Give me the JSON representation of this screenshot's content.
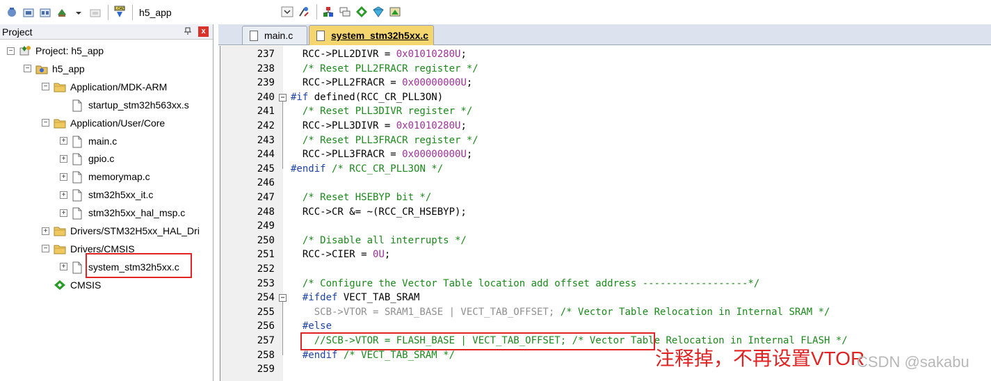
{
  "toolbar": {
    "target_label": "h5_app"
  },
  "project_panel": {
    "title": "Project",
    "pin": "ᴥ",
    "close": "x",
    "tree": [
      {
        "label": "Project: h5_app",
        "level": 0,
        "expanded": true,
        "icon": "project-icon"
      },
      {
        "label": "h5_app",
        "level": 1,
        "expanded": true,
        "icon": "target-icon"
      },
      {
        "label": "Application/MDK-ARM",
        "level": 2,
        "expanded": true,
        "icon": "folder-icon"
      },
      {
        "label": "startup_stm32h563xx.s",
        "level": 3,
        "expanded": null,
        "icon": "file-icon"
      },
      {
        "label": "Application/User/Core",
        "level": 2,
        "expanded": true,
        "icon": "folder-icon"
      },
      {
        "label": "main.c",
        "level": 3,
        "expanded": false,
        "icon": "file-icon"
      },
      {
        "label": "gpio.c",
        "level": 3,
        "expanded": false,
        "icon": "file-icon"
      },
      {
        "label": "memorymap.c",
        "level": 3,
        "expanded": false,
        "icon": "file-icon"
      },
      {
        "label": "stm32h5xx_it.c",
        "level": 3,
        "expanded": false,
        "icon": "file-icon"
      },
      {
        "label": "stm32h5xx_hal_msp.c",
        "level": 3,
        "expanded": false,
        "icon": "file-icon"
      },
      {
        "label": "Drivers/STM32H5xx_HAL_Dri",
        "level": 2,
        "expanded": false,
        "icon": "folder-icon"
      },
      {
        "label": "Drivers/CMSIS",
        "level": 2,
        "expanded": true,
        "icon": "folder-icon"
      },
      {
        "label": "system_stm32h5xx.c",
        "level": 3,
        "expanded": false,
        "icon": "file-icon"
      },
      {
        "label": "CMSIS",
        "level": 2,
        "expanded": null,
        "icon": "cmsis-icon"
      }
    ]
  },
  "tabs": [
    {
      "label": "main.c",
      "active": false
    },
    {
      "label": "system_stm32h5xx.c",
      "active": true
    }
  ],
  "editor": {
    "lines": [
      {
        "n": "237",
        "segs": [
          [
            "t",
            "  RCC->PLL2DIVR = "
          ],
          [
            "num",
            "0x01010280U"
          ],
          [
            "t",
            ";"
          ]
        ]
      },
      {
        "n": "238",
        "segs": [
          [
            "cm",
            "  /* Reset PLL2FRACR register */"
          ]
        ]
      },
      {
        "n": "239",
        "segs": [
          [
            "t",
            "  RCC->PLL2FRACR = "
          ],
          [
            "num",
            "0x00000000U"
          ],
          [
            "t",
            ";"
          ]
        ]
      },
      {
        "n": "240",
        "segs": [
          [
            "pp",
            "#if "
          ],
          [
            "t",
            "defined(RCC_CR_PLL3ON)"
          ]
        ],
        "fold": "-"
      },
      {
        "n": "241",
        "segs": [
          [
            "cm",
            "  /* Reset PLL3DIVR register */"
          ]
        ]
      },
      {
        "n": "242",
        "segs": [
          [
            "t",
            "  RCC->PLL3DIVR = "
          ],
          [
            "num",
            "0x01010280U"
          ],
          [
            "t",
            ";"
          ]
        ]
      },
      {
        "n": "243",
        "segs": [
          [
            "cm",
            "  /* Reset PLL3FRACR register */"
          ]
        ]
      },
      {
        "n": "244",
        "segs": [
          [
            "t",
            "  RCC->PLL3FRACR = "
          ],
          [
            "num",
            "0x00000000U"
          ],
          [
            "t",
            ";"
          ]
        ]
      },
      {
        "n": "245",
        "segs": [
          [
            "pp",
            "#endif "
          ],
          [
            "cm",
            "/* RCC_CR_PLL3ON */"
          ]
        ]
      },
      {
        "n": "246",
        "segs": [
          [
            "t",
            ""
          ]
        ]
      },
      {
        "n": "247",
        "segs": [
          [
            "cm",
            "  /* Reset HSEBYP bit */"
          ]
        ]
      },
      {
        "n": "248",
        "segs": [
          [
            "t",
            "  RCC->CR &= ~(RCC_CR_HSEBYP);"
          ]
        ]
      },
      {
        "n": "249",
        "segs": [
          [
            "t",
            ""
          ]
        ]
      },
      {
        "n": "250",
        "segs": [
          [
            "cm",
            "  /* Disable all interrupts */"
          ]
        ]
      },
      {
        "n": "251",
        "segs": [
          [
            "t",
            "  RCC->CIER = "
          ],
          [
            "num",
            "0U"
          ],
          [
            "t",
            ";"
          ]
        ]
      },
      {
        "n": "252",
        "segs": [
          [
            "t",
            ""
          ]
        ]
      },
      {
        "n": "253",
        "segs": [
          [
            "cm",
            "  /* Configure the Vector Table location add offset address ------------------*/"
          ]
        ]
      },
      {
        "n": "254",
        "segs": [
          [
            "pp",
            "  #ifdef "
          ],
          [
            "t",
            "VECT_TAB_SRAM"
          ]
        ],
        "fold": "-"
      },
      {
        "n": "255",
        "segs": [
          [
            "grey",
            "    SCB->VTOR = SRAM1_BASE | VECT_TAB_OFFSET; "
          ],
          [
            "cm",
            "/* Vector Table Relocation in Internal SRAM */"
          ]
        ]
      },
      {
        "n": "256",
        "segs": [
          [
            "pp",
            "  #else"
          ]
        ]
      },
      {
        "n": "257",
        "segs": [
          [
            "cm",
            "    //SCB->VTOR = FLASH_BASE | VECT_TAB_OFFSET; /* Vector Table Relocation in Internal FLASH */"
          ]
        ]
      },
      {
        "n": "258",
        "segs": [
          [
            "pp",
            "  #endif "
          ],
          [
            "cm",
            "/* VECT_TAB_SRAM */"
          ]
        ]
      },
      {
        "n": "259",
        "segs": [
          [
            "t",
            ""
          ]
        ]
      }
    ]
  },
  "annotation": "注释掉，不再设置VTOR",
  "watermark": "CSDN @sakabu",
  "colors": {
    "annotation_red": "#e02424",
    "active_tab": "#f5d66e",
    "comment_green": "#1a8a1a",
    "number_purple": "#a0309a"
  }
}
